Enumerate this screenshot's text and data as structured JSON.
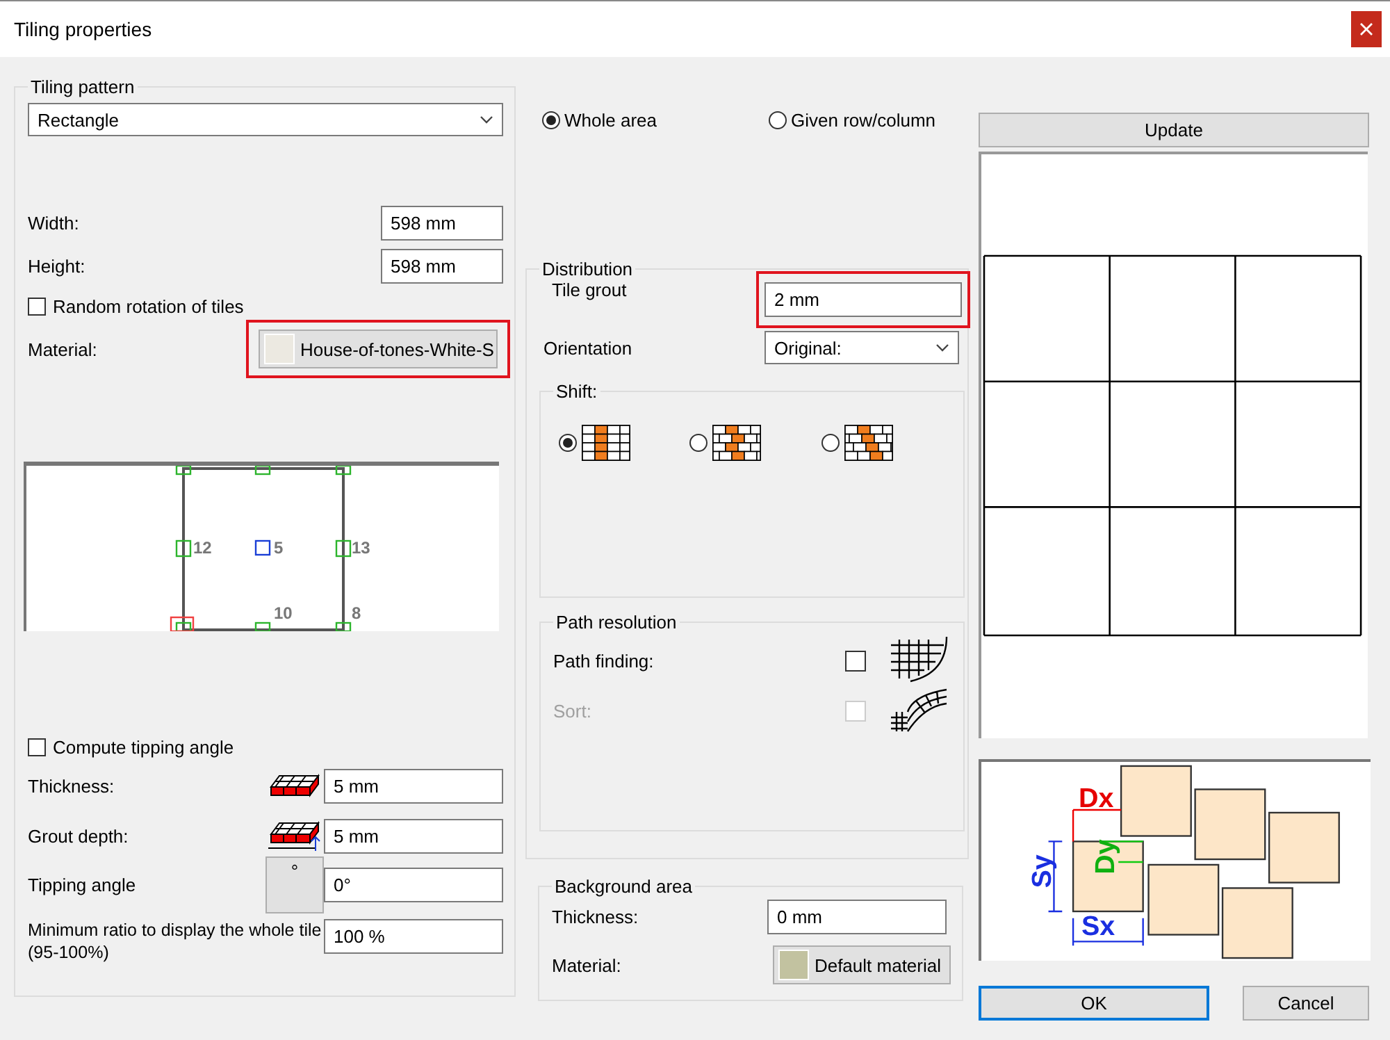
{
  "window": {
    "title": "Tiling properties"
  },
  "tiling_pattern": {
    "title": "Tiling pattern",
    "pattern": "Rectangle",
    "fields": [
      {
        "label": "Width:",
        "value": "598 mm"
      },
      {
        "label": "Height:",
        "value": "598 mm"
      }
    ],
    "random_rotation": {
      "label": "Random rotation of tiles",
      "checked": false
    },
    "material": {
      "label": "Material:",
      "value": "House-of-tones-White-S",
      "highlighted": true
    },
    "preview_labels": [
      "12",
      "5",
      "13",
      "10",
      "8"
    ],
    "compute_tipping": {
      "label": "Compute tipping angle",
      "checked": false
    },
    "thickness": {
      "label": "Thickness:",
      "value": "5 mm"
    },
    "grout_depth": {
      "label": "Grout depth:",
      "value": "5 mm"
    },
    "tipping_angle": {
      "label": "Tipping angle",
      "symbol": "°",
      "value": "0°"
    },
    "min_ratio": {
      "label": "Minimum ratio to display the whole tile (95-100%)",
      "value": "100 %"
    }
  },
  "area": [
    {
      "label": "Whole area",
      "selected": true
    },
    {
      "label": "Given row/column",
      "selected": false
    }
  ],
  "distribution": {
    "title": "Distribution",
    "tile_grout": {
      "label": "Tile grout",
      "value": "2 mm",
      "highlighted": true
    },
    "orientation": {
      "label": "Orientation",
      "value": "Original:"
    },
    "shift": {
      "title": "Shift:",
      "options": [
        {
          "kind": "none",
          "selected": true
        },
        {
          "kind": "half",
          "selected": false
        },
        {
          "kind": "third",
          "selected": false
        }
      ]
    },
    "path_resolution": {
      "title": "Path resolution",
      "options": [
        {
          "kind": "grid",
          "label": "Path finding:",
          "checked": false,
          "disabled": false
        },
        {
          "kind": "arc",
          "label": "Sort:",
          "checked": false,
          "disabled": true
        }
      ]
    }
  },
  "background_area": {
    "title": "Background area",
    "thickness": {
      "label": "Thickness:",
      "value": "0 mm"
    },
    "material": {
      "label": "Material:",
      "value": "Default material"
    }
  },
  "update_button": "Update",
  "diagram_labels": [
    "Dx",
    "Dy",
    "Sy",
    "Sx"
  ],
  "buttons": [
    {
      "label": "OK",
      "focused": true
    },
    {
      "label": "Cancel",
      "focused": false
    }
  ]
}
